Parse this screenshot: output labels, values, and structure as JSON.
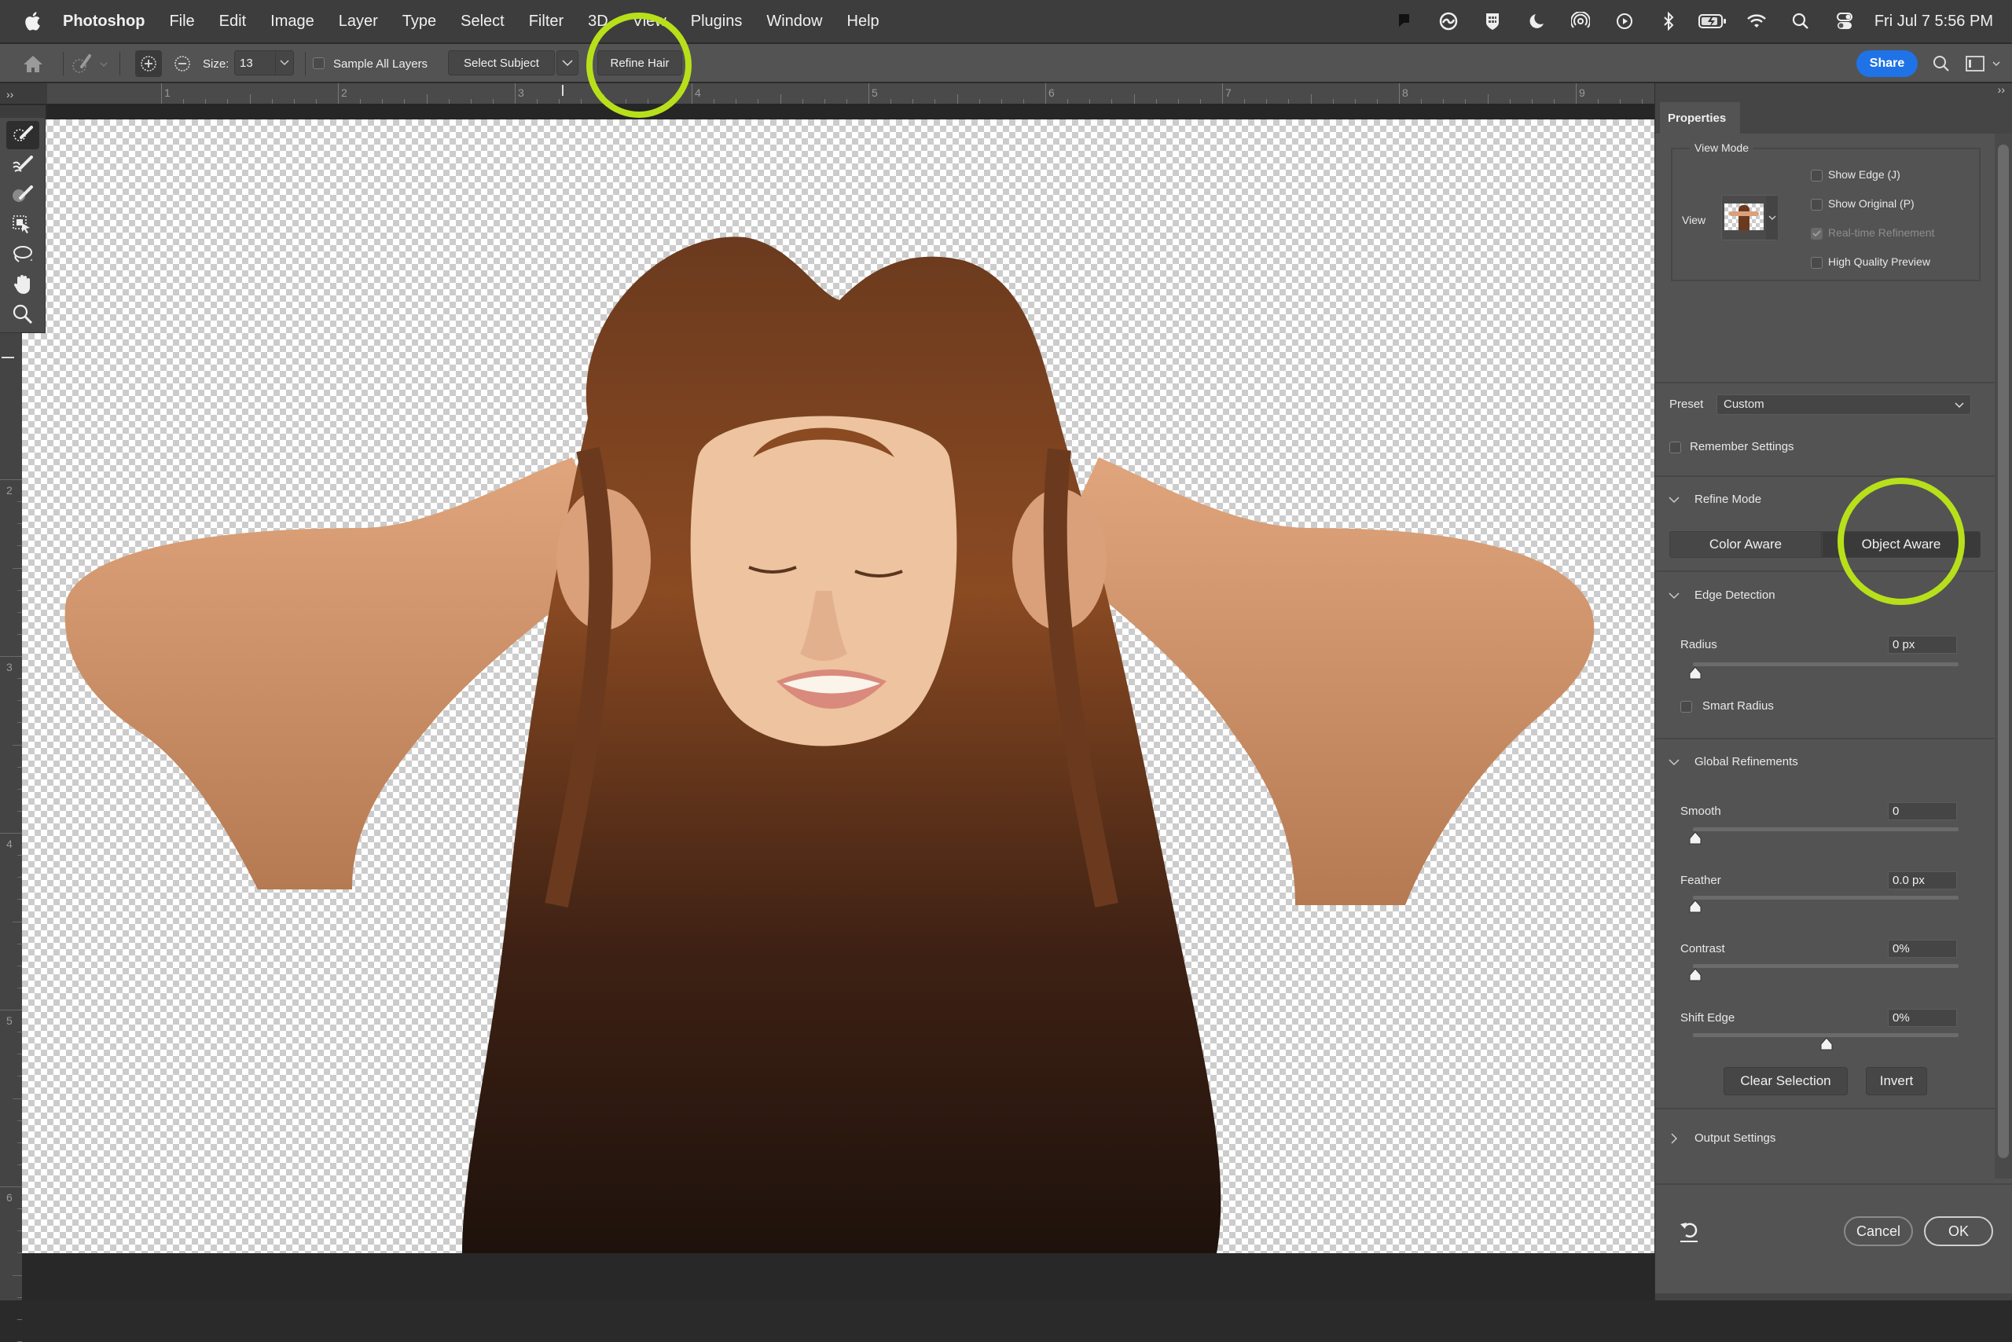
{
  "menubar": {
    "app_name": "Photoshop",
    "items": [
      "File",
      "Edit",
      "Image",
      "Layer",
      "Type",
      "Select",
      "Filter",
      "3D",
      "View",
      "Plugins",
      "Window",
      "Help"
    ],
    "status_icons": [
      "notes-app-icon",
      "creative-cloud-icon",
      "vpn-shield-icon",
      "do-not-disturb-moon-icon",
      "airdrop-icon",
      "play-circle-icon",
      "bluetooth-icon",
      "battery-charging-icon",
      "wifi-icon",
      "spotlight-search-icon",
      "control-center-icon"
    ],
    "clock": "Fri Jul 7  5:56 PM"
  },
  "options_bar": {
    "size_label": "Size:",
    "size_value": "13",
    "sample_all_layers_label": "Sample All Layers",
    "sample_all_layers_checked": false,
    "select_subject_label": "Select Subject",
    "refine_hair_label": "Refine Hair",
    "share_label": "Share"
  },
  "ruler": {
    "horizontal_labels": [
      "1",
      "2",
      "3",
      "4",
      "5",
      "6",
      "7",
      "8",
      "9"
    ],
    "vertical_labels": [
      "2",
      "3",
      "4",
      "5",
      "6"
    ],
    "collapse_label": "››"
  },
  "tools": [
    {
      "name": "quick-selection-tool",
      "active": true
    },
    {
      "name": "refine-edge-brush-tool",
      "active": false
    },
    {
      "name": "brush-tool",
      "active": false
    },
    {
      "name": "object-selection-tool",
      "active": false
    },
    {
      "name": "lasso-tool",
      "active": false
    },
    {
      "name": "hand-tool",
      "active": false
    },
    {
      "name": "zoom-tool",
      "active": false
    }
  ],
  "panel": {
    "collapse_label": "››",
    "tab_label": "Properties",
    "view_mode": {
      "legend": "View Mode",
      "view_label": "View",
      "checkboxes": [
        {
          "label": "Show Edge (J)",
          "checked": false,
          "disabled": false
        },
        {
          "label": "Show Original (P)",
          "checked": false,
          "disabled": false
        },
        {
          "label": "Real-time Refinement",
          "checked": true,
          "disabled": true
        },
        {
          "label": "High Quality Preview",
          "checked": false,
          "disabled": false
        }
      ]
    },
    "preset_label": "Preset",
    "preset_value": "Custom",
    "remember_settings_label": "Remember Settings",
    "remember_settings_checked": false,
    "refine_mode": {
      "title": "Refine Mode",
      "options": [
        "Color Aware",
        "Object Aware"
      ],
      "selected": "Object Aware"
    },
    "edge_detection": {
      "title": "Edge Detection",
      "radius_label": "Radius",
      "radius_value": "0 px",
      "radius_fraction": 0.0,
      "smart_radius_label": "Smart Radius",
      "smart_radius_checked": false
    },
    "global_refinements": {
      "title": "Global Refinements",
      "sliders": [
        {
          "label": "Smooth",
          "value": "0",
          "fraction": 0.0
        },
        {
          "label": "Feather",
          "value": "0.0 px",
          "fraction": 0.0
        },
        {
          "label": "Contrast",
          "value": "0%",
          "fraction": 0.0
        },
        {
          "label": "Shift Edge",
          "value": "0%",
          "fraction": 0.5
        }
      ]
    },
    "clear_selection_label": "Clear Selection",
    "invert_label": "Invert",
    "output_settings_title": "Output Settings",
    "cancel_label": "Cancel",
    "ok_label": "OK"
  },
  "annotation_color": "#b8e01a",
  "accent_color": "#1f73e6"
}
